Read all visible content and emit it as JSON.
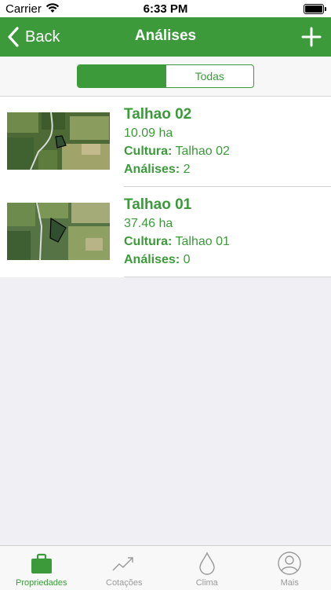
{
  "status_bar": {
    "carrier": "Carrier",
    "time": "6:33 PM"
  },
  "nav": {
    "back_label": "Back",
    "title": "Análises"
  },
  "segment": {
    "first_label": "",
    "second_label": "Todas"
  },
  "plots": [
    {
      "name": "Talhao 02",
      "area": "10.09 ha",
      "cultura_label": "Cultura:",
      "cultura_value": "Talhao 02",
      "analises_label": "Análises:",
      "analises_value": "2"
    },
    {
      "name": "Talhao 01",
      "area": "37.46 ha",
      "cultura_label": "Cultura:",
      "cultura_value": "Talhao 01",
      "analises_label": "Análises:",
      "analises_value": "0"
    }
  ],
  "tabs": [
    {
      "label": "Propriedades",
      "icon": "briefcase-icon"
    },
    {
      "label": "Cotações",
      "icon": "trending-up-icon"
    },
    {
      "label": "Clima",
      "icon": "droplet-icon"
    },
    {
      "label": "Mais",
      "icon": "person-icon"
    }
  ],
  "colors": {
    "brand_green": "#3c9a3b",
    "background": "#efeff4",
    "tab_inactive": "#9a9a9a"
  }
}
